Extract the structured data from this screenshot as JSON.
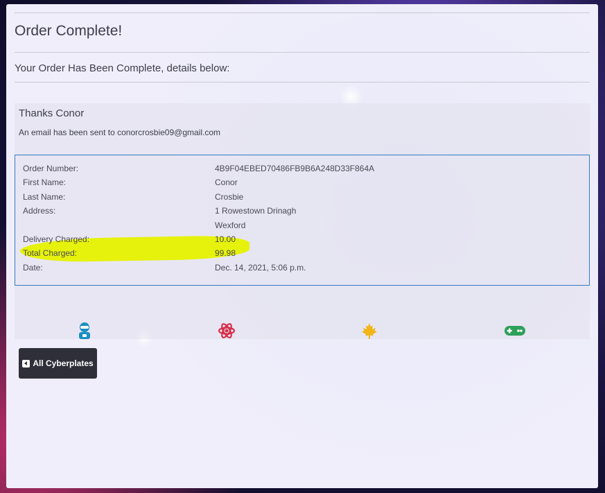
{
  "page": {
    "title": "Order Complete!",
    "subtitle": "Your Order Has Been Complete, details below:"
  },
  "confirmation": {
    "thanks": "Thanks Conor",
    "email_note": "An email has been sent to conorcrosbie09@gmail.com"
  },
  "order": {
    "rows": [
      {
        "label": "Order Number:",
        "value": "4B9F04EBED70486FB9B6A248D33F864A"
      },
      {
        "label": "First Name:",
        "value": "Conor"
      },
      {
        "label": "Last Name:",
        "value": "Crosbie"
      },
      {
        "label": "Address:",
        "value": "1 Rowestown Drinagh"
      },
      {
        "label": "",
        "value": "Wexford"
      },
      {
        "label": "Delivery Charged:",
        "value": "10.00"
      },
      {
        "label": "Total Charged:",
        "value": "99.98"
      },
      {
        "label": "Date:",
        "value": "Dec. 14, 2021, 5:06 p.m."
      }
    ]
  },
  "icons": [
    {
      "name": "robot-icon",
      "color": "#1b8fc4"
    },
    {
      "name": "atom-icon",
      "color": "#d6304a"
    },
    {
      "name": "maple-leaf-icon",
      "color": "#f2b515"
    },
    {
      "name": "gamepad-icon",
      "color": "#2ea05a"
    }
  ],
  "button": {
    "label": "All Cyberplates"
  },
  "colors": {
    "highlight": "#e6f20b",
    "details_border": "#2f7cc4",
    "button_bg": "#2f2f3a"
  }
}
